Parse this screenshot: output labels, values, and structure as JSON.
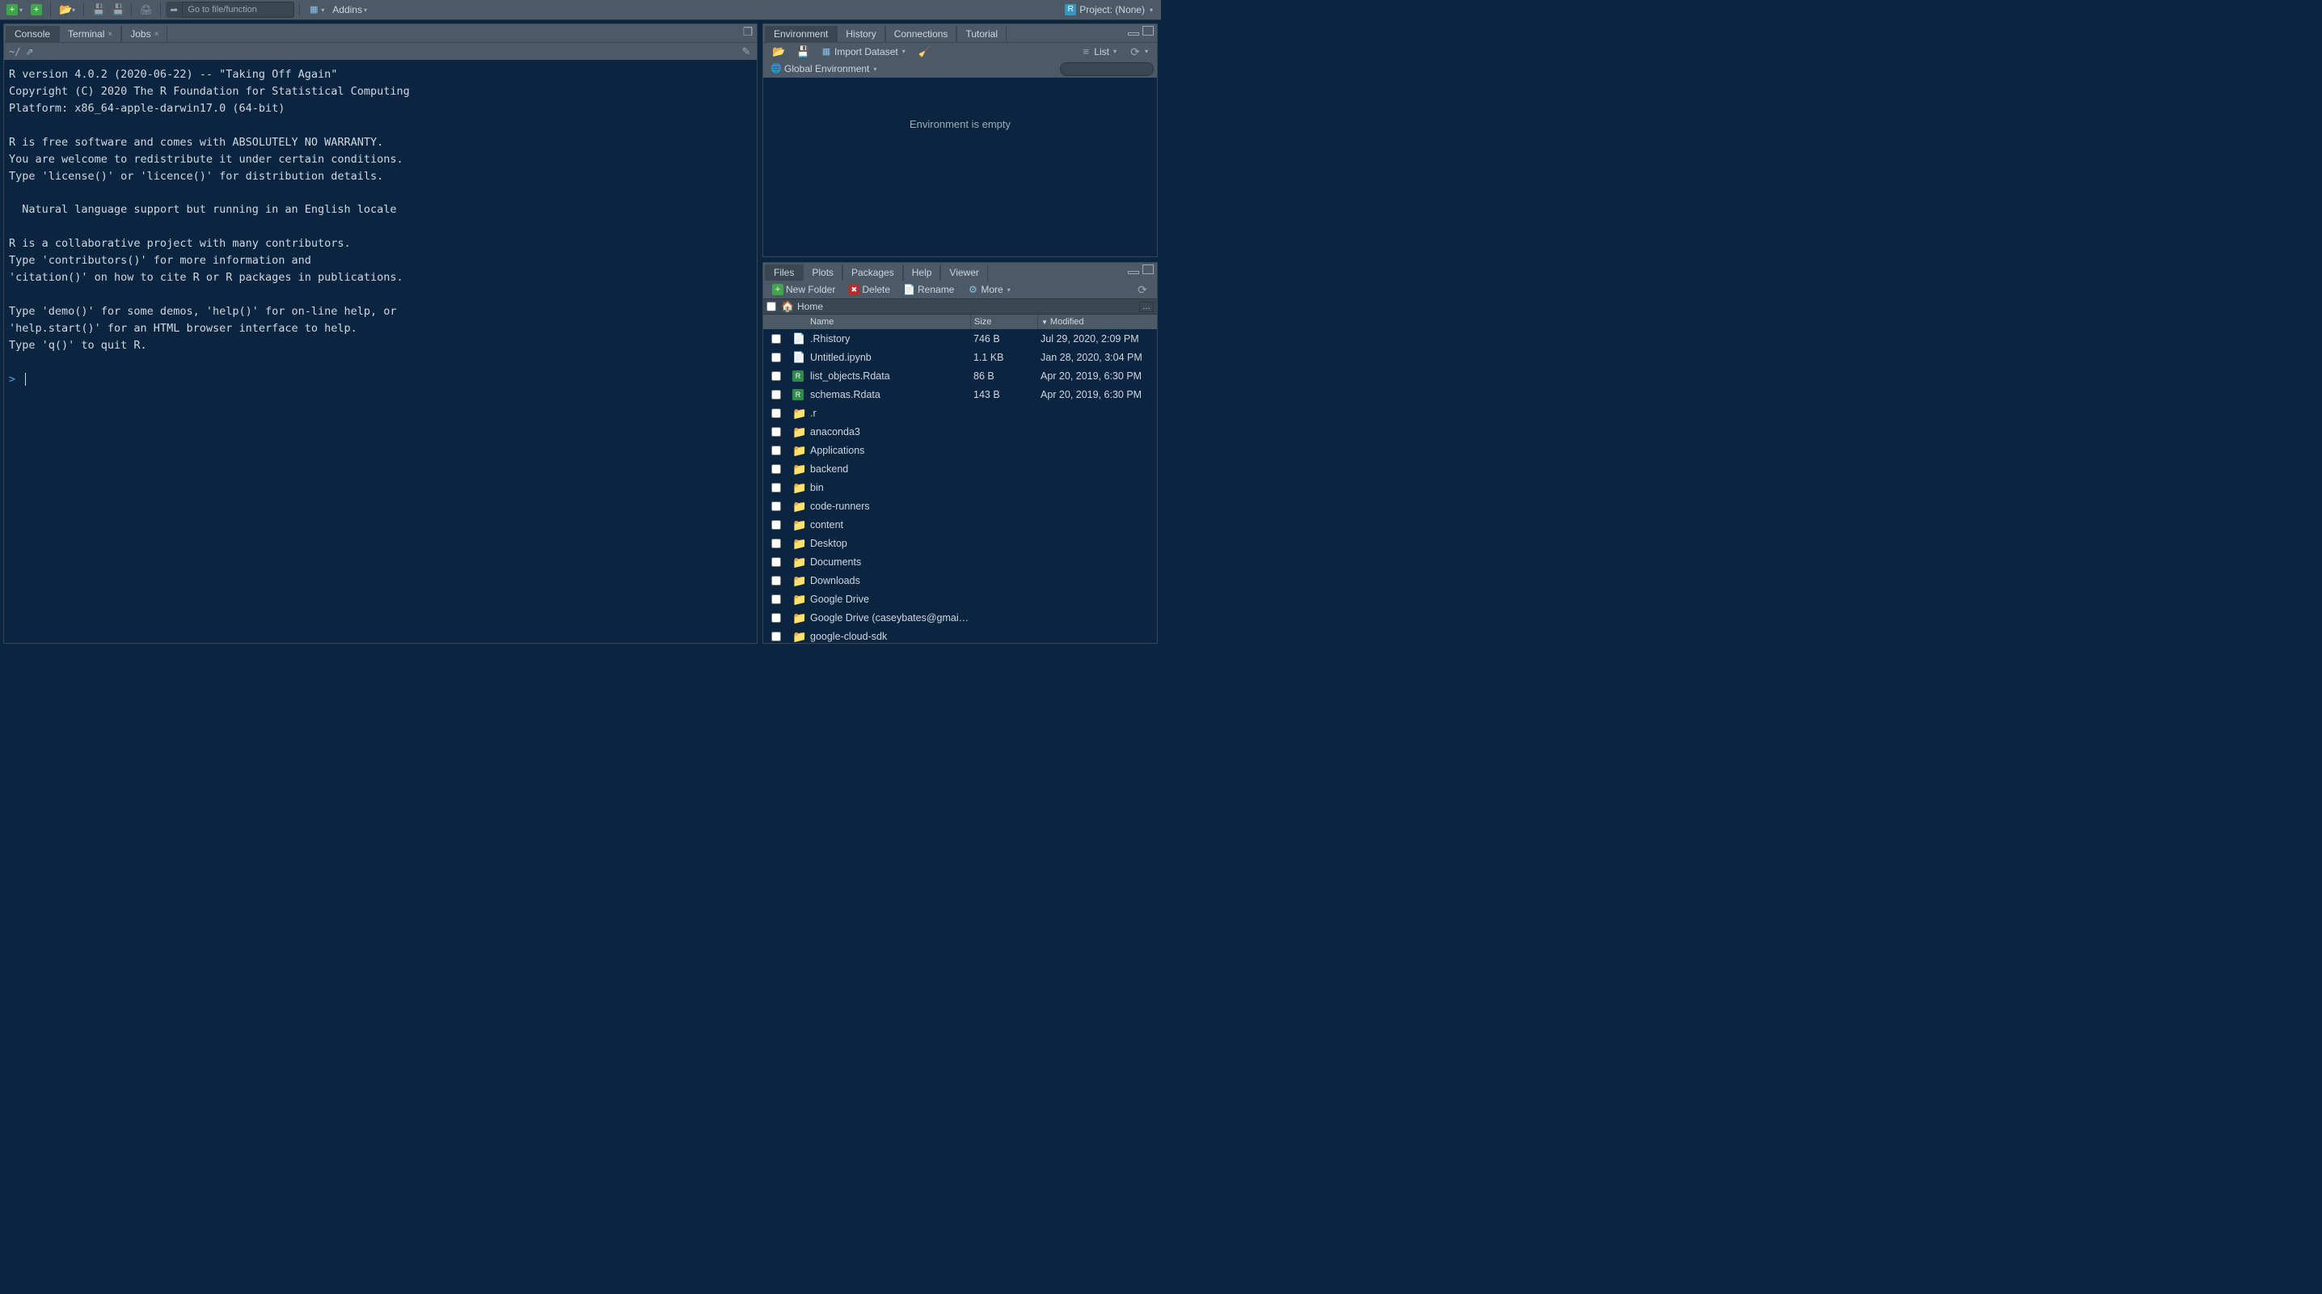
{
  "toolbar": {
    "goto_placeholder": "Go to file/function",
    "addins_label": "Addins",
    "project_label": "Project: (None)"
  },
  "console": {
    "tabs": [
      "Console",
      "Terminal",
      "Jobs"
    ],
    "path": "~/",
    "text": "R version 4.0.2 (2020-06-22) -- \"Taking Off Again\"\nCopyright (C) 2020 The R Foundation for Statistical Computing\nPlatform: x86_64-apple-darwin17.0 (64-bit)\n\nR is free software and comes with ABSOLUTELY NO WARRANTY.\nYou are welcome to redistribute it under certain conditions.\nType 'license()' or 'licence()' for distribution details.\n\n  Natural language support but running in an English locale\n\nR is a collaborative project with many contributors.\nType 'contributors()' for more information and\n'citation()' on how to cite R or R packages in publications.\n\nType 'demo()' for some demos, 'help()' for on-line help, or\n'help.start()' for an HTML browser interface to help.\nType 'q()' to quit R.\n",
    "prompt": ">"
  },
  "environment": {
    "tabs": [
      "Environment",
      "History",
      "Connections",
      "Tutorial"
    ],
    "import_label": "Import Dataset",
    "list_label": "List",
    "scope_label": "Global Environment",
    "empty_msg": "Environment is empty"
  },
  "files": {
    "tabs": [
      "Files",
      "Plots",
      "Packages",
      "Help",
      "Viewer"
    ],
    "btn_new_folder": "New Folder",
    "btn_delete": "Delete",
    "btn_rename": "Rename",
    "btn_more": "More",
    "breadcrumb": "Home",
    "headers": {
      "name": "Name",
      "size": "Size",
      "modified": "Modified"
    },
    "rows": [
      {
        "icon": "file",
        "name": ".Rhistory",
        "size": "746 B",
        "modified": "Jul 29, 2020, 2:09 PM"
      },
      {
        "icon": "file",
        "name": "Untitled.ipynb",
        "size": "1.1 KB",
        "modified": "Jan 28, 2020, 3:04 PM"
      },
      {
        "icon": "rdata",
        "name": "list_objects.Rdata",
        "size": "86 B",
        "modified": "Apr 20, 2019, 6:30 PM"
      },
      {
        "icon": "rdata",
        "name": "schemas.Rdata",
        "size": "143 B",
        "modified": "Apr 20, 2019, 6:30 PM"
      },
      {
        "icon": "folder",
        "name": ".r",
        "size": "",
        "modified": ""
      },
      {
        "icon": "folder",
        "name": "anaconda3",
        "size": "",
        "modified": ""
      },
      {
        "icon": "folder",
        "name": "Applications",
        "size": "",
        "modified": ""
      },
      {
        "icon": "folder",
        "name": "backend",
        "size": "",
        "modified": ""
      },
      {
        "icon": "folder",
        "name": "bin",
        "size": "",
        "modified": ""
      },
      {
        "icon": "folder",
        "name": "code-runners",
        "size": "",
        "modified": ""
      },
      {
        "icon": "folder",
        "name": "content",
        "size": "",
        "modified": ""
      },
      {
        "icon": "folder",
        "name": "Desktop",
        "size": "",
        "modified": ""
      },
      {
        "icon": "folder",
        "name": "Documents",
        "size": "",
        "modified": ""
      },
      {
        "icon": "folder",
        "name": "Downloads",
        "size": "",
        "modified": ""
      },
      {
        "icon": "folder",
        "name": "Google Drive",
        "size": "",
        "modified": ""
      },
      {
        "icon": "folder",
        "name": "Google Drive (caseybates@gmai…",
        "size": "",
        "modified": ""
      },
      {
        "icon": "folder",
        "name": "google-cloud-sdk",
        "size": "",
        "modified": ""
      }
    ]
  }
}
